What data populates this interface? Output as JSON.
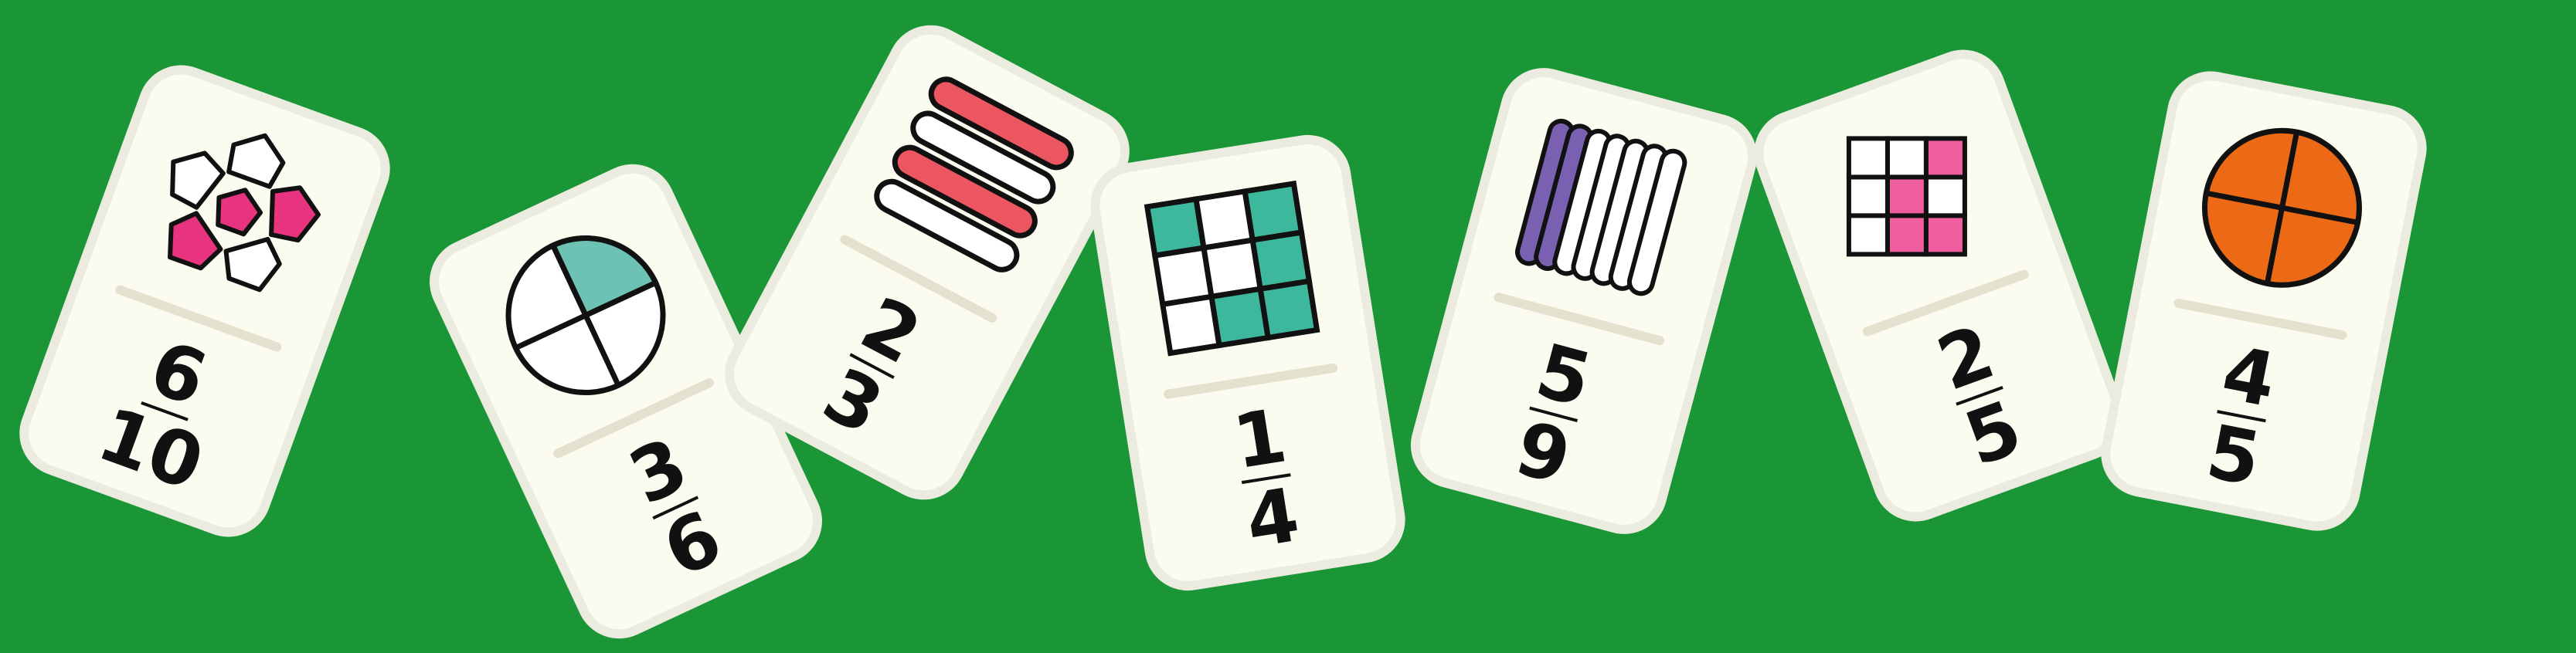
{
  "colors": {
    "background": "#1a9637",
    "tile": "#fbfbf0",
    "tile_border": "#ecebdf",
    "pink": "#e8337f",
    "teal": "#6cc3b3",
    "red": "#ec5660",
    "grid_teal": "#3db89c",
    "purple": "#7a60b0",
    "light_pink": "#ef5fa0",
    "orange": "#ec6a15"
  },
  "dominoes": [
    {
      "picture": "pentagon-flower-icon",
      "numerator": "6",
      "denominator": "10"
    },
    {
      "picture": "quarter-circle-icon",
      "numerator": "3",
      "denominator": "6"
    },
    {
      "picture": "stacked-bars-icon",
      "numerator": "2",
      "denominator": "3"
    },
    {
      "picture": "square-grid-icon",
      "numerator": "1",
      "denominator": "4"
    },
    {
      "picture": "pill-columns-icon",
      "numerator": "5",
      "denominator": "9"
    },
    {
      "picture": "square-cross-icon",
      "numerator": "2",
      "denominator": "5"
    },
    {
      "picture": "orange-circle-icon",
      "numerator": "4",
      "denominator": "5"
    }
  ]
}
